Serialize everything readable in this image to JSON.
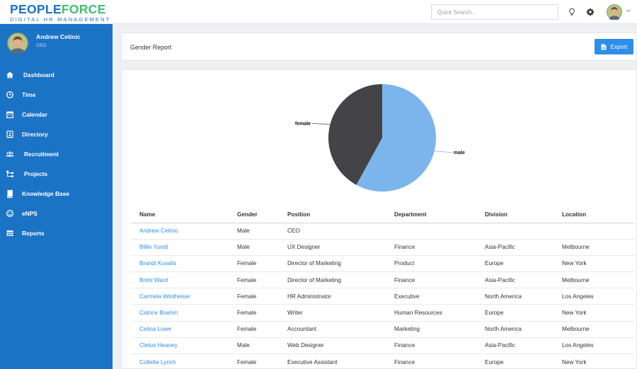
{
  "logo": {
    "part1": "PEOPLE",
    "part2": "FORCE",
    "tagline": "DIGITAL HR MANAGEMENT"
  },
  "search": {
    "placeholder": "Quick Search..."
  },
  "topbar": {
    "icons": [
      "bulb-icon",
      "gear-icon",
      "user-avatar",
      "chevron-down-icon"
    ]
  },
  "user": {
    "name": "Andrew Cetinic",
    "role": "CEO"
  },
  "sidebar": {
    "items": [
      {
        "label": "Dashboard",
        "icon": "home-icon"
      },
      {
        "label": "Time",
        "icon": "clock-icon"
      },
      {
        "label": "Calendar",
        "icon": "calendar-icon"
      },
      {
        "label": "Directory",
        "icon": "directory-icon"
      },
      {
        "label": "Recruitment",
        "icon": "people-icon"
      },
      {
        "label": "Projects",
        "icon": "sitemap-icon"
      },
      {
        "label": "Knowledge Base",
        "icon": "book-icon"
      },
      {
        "label": "eNPS",
        "icon": "smile-icon"
      },
      {
        "label": "Reports",
        "icon": "table-icon"
      }
    ]
  },
  "page": {
    "title": "Gender Report",
    "export_label": "Export"
  },
  "colors": {
    "sidebar": "#1b73c6",
    "accent": "#2e8ee8",
    "male": "#7cb5ec",
    "female": "#434348",
    "logo_green": "#3fbf6d"
  },
  "chart_data": {
    "type": "pie",
    "title": "",
    "slices": [
      {
        "label": "male",
        "value": 58
      },
      {
        "label": "female",
        "value": 42
      }
    ]
  },
  "table": {
    "columns": [
      "Name",
      "Gender",
      "Position",
      "Department",
      "Division",
      "Location"
    ],
    "rows": [
      [
        "Andrew Cetinic",
        "Male",
        "CEO",
        "",
        "",
        ""
      ],
      [
        "Billie Yundt",
        "Male",
        "UX Designer",
        "Finance",
        "Asia-Pacific",
        "Melbourne"
      ],
      [
        "Brandi Kuvalis",
        "Female",
        "Director of Marketing",
        "Product",
        "Europe",
        "New York"
      ],
      [
        "Britni Ward",
        "Female",
        "Director of Marketing",
        "Finance",
        "Asia-Pacific",
        "Melbourne"
      ],
      [
        "Carmela Wintheiser",
        "Female",
        "HR Administrator",
        "Executive",
        "North America",
        "Los Angeles"
      ],
      [
        "Catrice Boehm",
        "Female",
        "Writer",
        "Human Resources",
        "Europe",
        "New York"
      ],
      [
        "Celina Lowe",
        "Female",
        "Accountant",
        "Marketing",
        "North America",
        "Melbourne"
      ],
      [
        "Cletus Heaney",
        "Male",
        "Web Designer",
        "Finance",
        "Asia-Pacific",
        "Los Angeles"
      ],
      [
        "Collette Lynch",
        "Female",
        "Executive Assistant",
        "Finance",
        "Europe",
        "New York"
      ]
    ]
  }
}
